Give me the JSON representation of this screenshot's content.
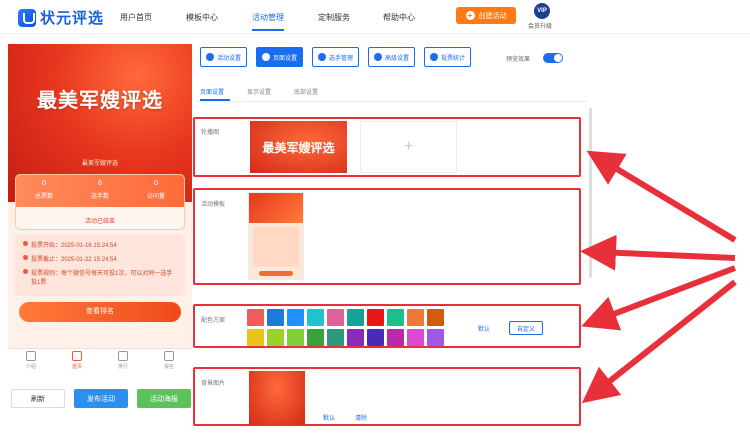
{
  "topnav": {
    "logo": "状元评选",
    "items": [
      "用户首页",
      "模板中心",
      "活动管理",
      "定制服务",
      "帮助中心"
    ],
    "active_item": "活动管理",
    "create_button": "创建活动",
    "vip_badge": "VIP",
    "vip_label": "会员升级"
  },
  "preview": {
    "title": "最美军嫂评选",
    "subtitle": "最美军嫂评选",
    "stats": [
      {
        "value": "0",
        "label": "总票数"
      },
      {
        "value": "6",
        "label": "选手数"
      },
      {
        "value": "0",
        "label": "访问量"
      }
    ],
    "ended_text": "活动已结束",
    "info": [
      "投票开始：2025-01-16 15:24:54",
      "投票截止：2025-01-22 15:24:54",
      "投票规则：每个微信号每天可投1次，可以对同一选手投1票"
    ],
    "rank_button": "查看排名",
    "tabs": [
      "介绍",
      "首页",
      "排行",
      "报名"
    ],
    "active_tab": "首页"
  },
  "bottom_buttons": {
    "refresh": "刷新",
    "publish": "发布活动",
    "poster": "活动海报"
  },
  "toolbar": {
    "buttons": [
      "活动设置",
      "页面设置",
      "选手管理",
      "高级设置",
      "投票统计"
    ],
    "active": "页面设置",
    "preview_label": "预览效果",
    "preview_on": true
  },
  "subtabs": {
    "items": [
      "页面设置",
      "显示设置",
      "底部设置"
    ],
    "active": "页面设置"
  },
  "sections": {
    "carousel": {
      "label": "轮播图",
      "image_text": "最美军嫂评选",
      "add_symbol": "+"
    },
    "template": {
      "label": "活动模板"
    },
    "color_scheme": {
      "label": "配色方案",
      "colors": [
        "#f25b5b",
        "#1e7ad6",
        "#1e90ff",
        "#20c4d0",
        "#e0609a",
        "#12a39a",
        "#e81818",
        "#1cc08a",
        "#f2763a",
        "#d45a10",
        "#e8c418",
        "#9ad12a",
        "#7fd03a",
        "#3aa23a",
        "#2a9a7a",
        "#8a2ab8",
        "#4a2ab8",
        "#b82aa8",
        "#d84ad0",
        "#a058e8"
      ],
      "reset": "默认",
      "custom": "自定义"
    },
    "background": {
      "label": "背景图片",
      "reset": "默认",
      "clear": "清除"
    }
  }
}
